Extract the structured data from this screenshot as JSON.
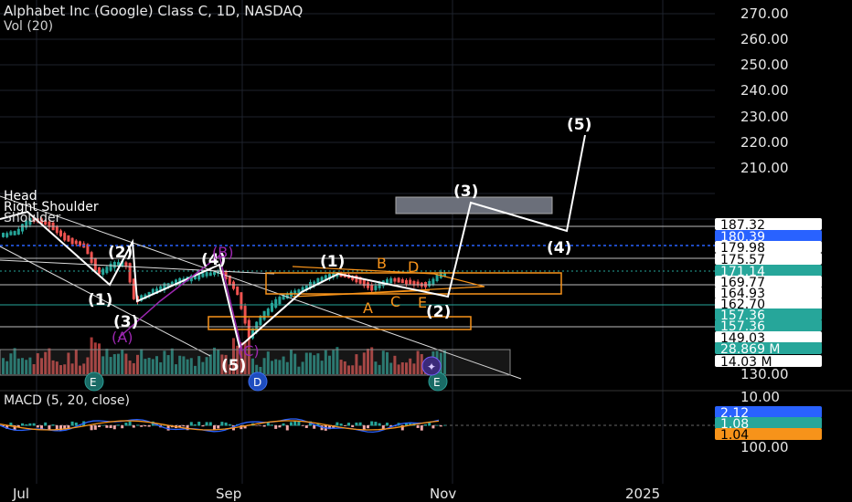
{
  "header": {
    "title": "Alphabet Inc (Google) Class C, 1D, NASDAQ",
    "volume_label": "Vol (20)"
  },
  "macd": {
    "label": "MACD (5, 20, close)"
  },
  "colors": {
    "up": "#26a69a",
    "down": "#ef5350",
    "price_blue": "#2962ff",
    "orange": "#f7931a",
    "purple": "#9c27b0",
    "grid": "#1e222d"
  },
  "chart_data": {
    "type": "candlestick",
    "ylim": [
      130,
      275
    ],
    "y_ticks": [
      130,
      140,
      150,
      160,
      170,
      180,
      190,
      200,
      210,
      220,
      230,
      240,
      250,
      260,
      270
    ],
    "y_tick_labels": [
      "130.00",
      "",
      "",
      "",
      "",
      "",
      "",
      "",
      "210.00",
      "220.00",
      "230.00",
      "240.00",
      "250.00",
      "260.00",
      "270.00"
    ],
    "x_labels": [
      "Jul",
      "Sep",
      "Nov",
      "2025"
    ],
    "price_tags": [
      {
        "value": "187.32",
        "style": "white"
      },
      {
        "value": "180.39",
        "style": "blue"
      },
      {
        "value": "179.98",
        "style": "white"
      },
      {
        "value": "175.57",
        "style": "white"
      },
      {
        "value": "171.14",
        "style": "green"
      },
      {
        "value": "169.77",
        "style": "white"
      },
      {
        "value": "164.93",
        "style": "white"
      },
      {
        "value": "162.70",
        "style": "white"
      },
      {
        "value": "157.36",
        "style": "green"
      },
      {
        "value": "157.36",
        "style": "green"
      },
      {
        "value": "149.03",
        "style": "white"
      },
      {
        "value": "28.869 M",
        "style": "green"
      },
      {
        "value": "14.03 M",
        "style": "white"
      }
    ],
    "macd_axis": [
      "10.00",
      "100.00"
    ],
    "macd_tags": [
      {
        "value": "2.12",
        "style": "blue"
      },
      {
        "value": "1.08",
        "style": "green"
      },
      {
        "value": "1.04",
        "style": "orange"
      }
    ],
    "wave_labels": [
      "(1)",
      "(2)",
      "(3)",
      "(4)",
      "(5)",
      "(1)",
      "(2)",
      "(3)",
      "(4)",
      "(5)",
      "(1)",
      "(2)",
      "(3)",
      "(4)",
      "(5)"
    ],
    "pattern_labels": [
      "(A)",
      "(B)",
      "(C)",
      "A",
      "B",
      "C",
      "D",
      "E"
    ],
    "annotations": [
      "Head",
      "Right Shoulder",
      "Shoulder"
    ],
    "event_markers": [
      "E",
      "D",
      "E"
    ]
  }
}
